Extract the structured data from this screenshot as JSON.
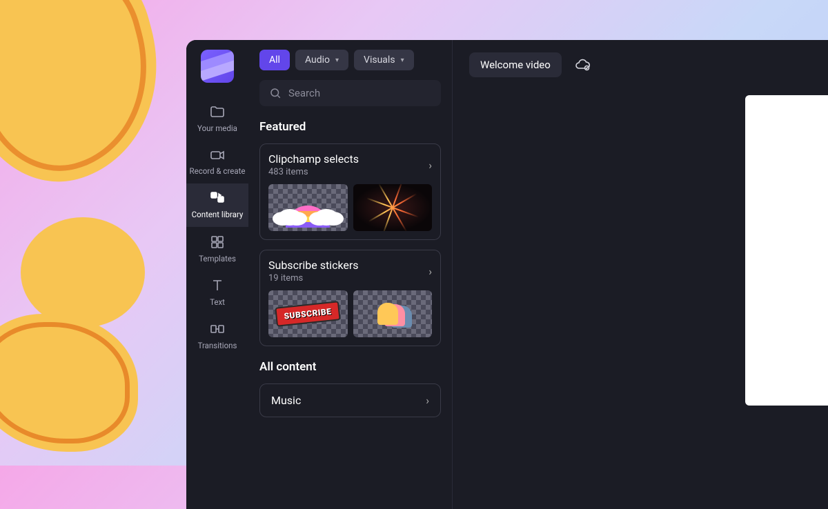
{
  "sidebar": {
    "items": [
      {
        "label": "Your media"
      },
      {
        "label": "Record & create"
      },
      {
        "label": "Content library"
      },
      {
        "label": "Templates"
      },
      {
        "label": "Text"
      },
      {
        "label": "Transitions"
      }
    ]
  },
  "filters": {
    "all": "All",
    "audio": "Audio",
    "visuals": "Visuals"
  },
  "search": {
    "placeholder": "Search"
  },
  "featured": {
    "title": "Featured",
    "collections": [
      {
        "title": "Clipchamp selects",
        "sub": "483 items"
      },
      {
        "title": "Subscribe stickers",
        "sub": "19 items"
      }
    ]
  },
  "all_content": {
    "title": "All content",
    "rows": [
      {
        "label": "Music"
      }
    ]
  },
  "project": {
    "name": "Welcome video"
  },
  "thumbs": {
    "subscribe_text": "SUBSCRIBE"
  }
}
